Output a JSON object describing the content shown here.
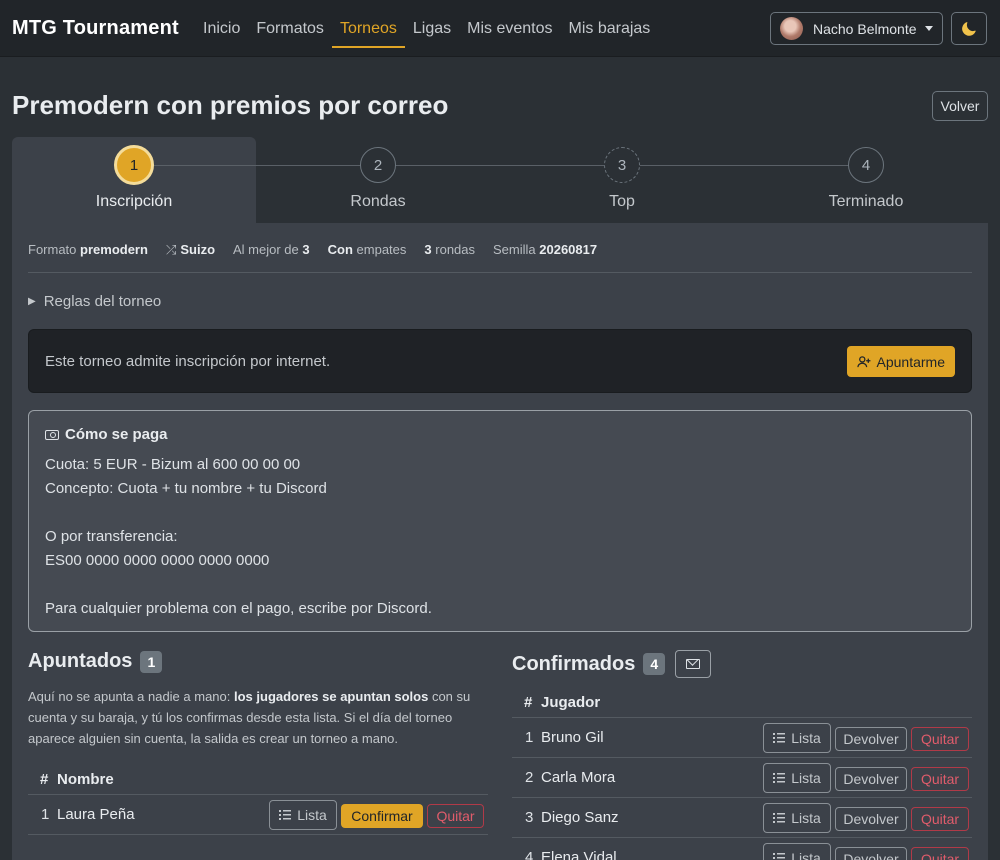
{
  "nav": {
    "brand": "MTG Tournament",
    "links": [
      "Inicio",
      "Formatos",
      "Torneos",
      "Ligas",
      "Mis eventos",
      "Mis barajas"
    ],
    "active_link": "Torneos",
    "user_name": "Nacho Belmonte",
    "theme_icon": "moon-icon"
  },
  "page": {
    "title": "Premodern con premios por correo",
    "back_label": "Volver"
  },
  "steps": [
    {
      "number": "1",
      "label": "Inscripción",
      "state": "active"
    },
    {
      "number": "2",
      "label": "Rondas",
      "state": "pending"
    },
    {
      "number": "3",
      "label": "Top",
      "state": "pending-dashed"
    },
    {
      "number": "4",
      "label": "Terminado",
      "state": "pending"
    }
  ],
  "meta": {
    "format_label": "Formato",
    "format_value": "premodern",
    "pairing": "Suizo",
    "best_of_label": "Al mejor de",
    "best_of_value": "3",
    "draws_bold": "Con",
    "draws_label": "empates",
    "rounds_value": "3",
    "rounds_label": "rondas",
    "seed_label": "Semilla",
    "seed_value": "20260817"
  },
  "rules_label": "Reglas del torneo",
  "signup": {
    "text": "Este torneo admite inscripción por internet.",
    "button": "Apuntarme"
  },
  "payment": {
    "title": "Cómo se paga",
    "lines": [
      "Cuota: 5 EUR - Bizum al 600 00 00 00",
      "Concepto: Cuota + tu nombre + tu Discord",
      "",
      "O por transferencia:",
      "ES00 0000 0000 0000 0000 0000",
      "",
      "Para cualquier problema con el pago, escribe por Discord."
    ]
  },
  "apuntados": {
    "title": "Apuntados",
    "count": "1",
    "note_pre": "Aquí no se apunta a nadie a mano: ",
    "note_bold": "los jugadores se apuntan solos",
    "note_post": " con su cuenta y su baraja, y tú los confirmas desde esta lista. Si el día del torneo aparece alguien sin cuenta, la salida es crear un torneo a mano.",
    "col_num": "#",
    "col_name": "Nombre",
    "rows": [
      {
        "num": "1",
        "name": "Laura Peña"
      }
    ],
    "btn_list": "Lista",
    "btn_confirm": "Confirmar",
    "btn_remove": "Quitar"
  },
  "confirmados": {
    "title": "Confirmados",
    "count": "4",
    "col_num": "#",
    "col_name": "Jugador",
    "rows": [
      {
        "num": "1",
        "name": "Bruno Gil"
      },
      {
        "num": "2",
        "name": "Carla Mora"
      },
      {
        "num": "3",
        "name": "Diego Sanz"
      },
      {
        "num": "4",
        "name": "Elena Vidal"
      }
    ],
    "btn_list": "Lista",
    "btn_return": "Devolver",
    "btn_remove": "Quitar"
  },
  "colors": {
    "accent": "#e0a526",
    "danger": "#e05c6b",
    "bg": "#2b3035",
    "card": "#3c4149"
  }
}
